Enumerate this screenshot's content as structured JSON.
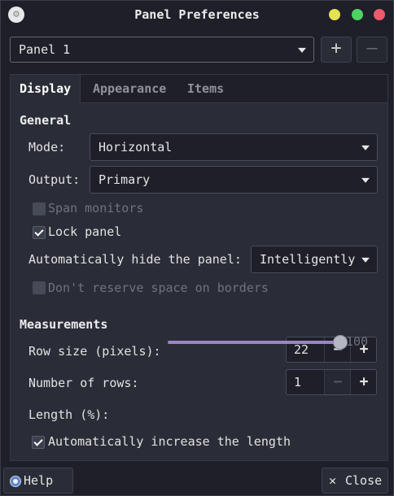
{
  "window": {
    "title": "Panel Preferences"
  },
  "panel_select": {
    "value": "Panel 1",
    "add_label": "+",
    "remove_label": "—"
  },
  "tabs": [
    {
      "label": "Display"
    },
    {
      "label": "Appearance"
    },
    {
      "label": "Items"
    }
  ],
  "general": {
    "heading": "General",
    "mode": {
      "label": "Mode:",
      "value": "Horizontal"
    },
    "output": {
      "label": "Output:",
      "value": "Primary"
    },
    "span_monitors": {
      "label": "Span monitors",
      "checked": false,
      "enabled": false
    },
    "lock_panel": {
      "label": "Lock panel",
      "checked": true
    },
    "autohide": {
      "label": "Automatically hide the panel:",
      "value": "Intelligently"
    },
    "dont_reserve": {
      "label": "Don't reserve space on borders",
      "checked": false,
      "enabled": false
    }
  },
  "measurements": {
    "heading": "Measurements",
    "row_size": {
      "label": "Row size (pixels):",
      "value": "22"
    },
    "num_rows": {
      "label": "Number of rows:",
      "value": "1"
    },
    "length": {
      "label": "Length (%):",
      "value": "100"
    },
    "auto_increase": {
      "label": "Automatically increase the length",
      "checked": true
    }
  },
  "footer": {
    "help_label": "Help",
    "close_label": "Close"
  },
  "colors": {
    "accent": "#9b86c4",
    "background": "#1e1f29",
    "surface": "#2a2c37"
  }
}
